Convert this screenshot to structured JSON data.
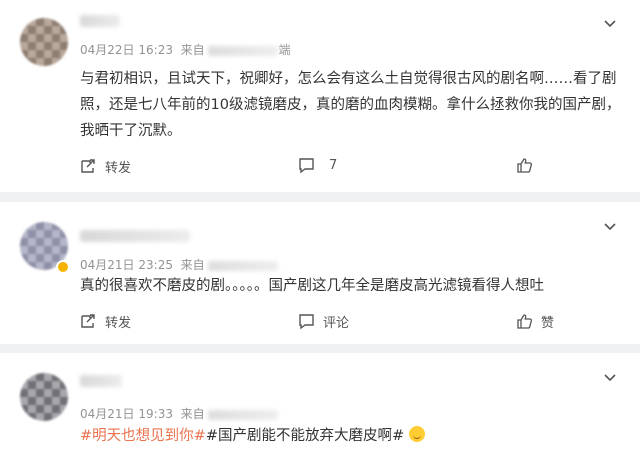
{
  "comments": [
    {
      "date": "04月22日",
      "time": "16:23",
      "source_prefix": "来自",
      "source_tail": "端",
      "text": "与君初相识，且试天下，祝卿好，怎么会有这么土自觉得很古风的剧名啊……看了剧照，还是七八年前的10级滤镜磨皮，真的磨的血肉模糊。拿什么拯救你我的国产剧，我晒干了沉默。",
      "repost_label": "转发",
      "comment_count": "7"
    },
    {
      "date": "04月21日",
      "time": "23:25",
      "source_prefix": "来自",
      "text": "真的很喜欢不磨皮的剧。。。。。国产剧这几年全是磨皮高光滤镜看得人想吐",
      "repost_label": "转发",
      "comment_label": "评论",
      "like_label": "赞"
    },
    {
      "date": "04月21日",
      "time": "19:33",
      "source_prefix": "来自",
      "hashtag1": "#明天也想见到你#",
      "hashtag2": "#国产剧能不能放弃大磨皮啊#"
    }
  ],
  "icons": [
    "chevron-down-icon",
    "repost-icon",
    "comment-icon",
    "like-icon",
    "verified-badge-icon",
    "grin-emoji-icon"
  ],
  "colors": {
    "hashtag": "#eb7350",
    "meta": "#939393",
    "badge": "#f5b200"
  }
}
